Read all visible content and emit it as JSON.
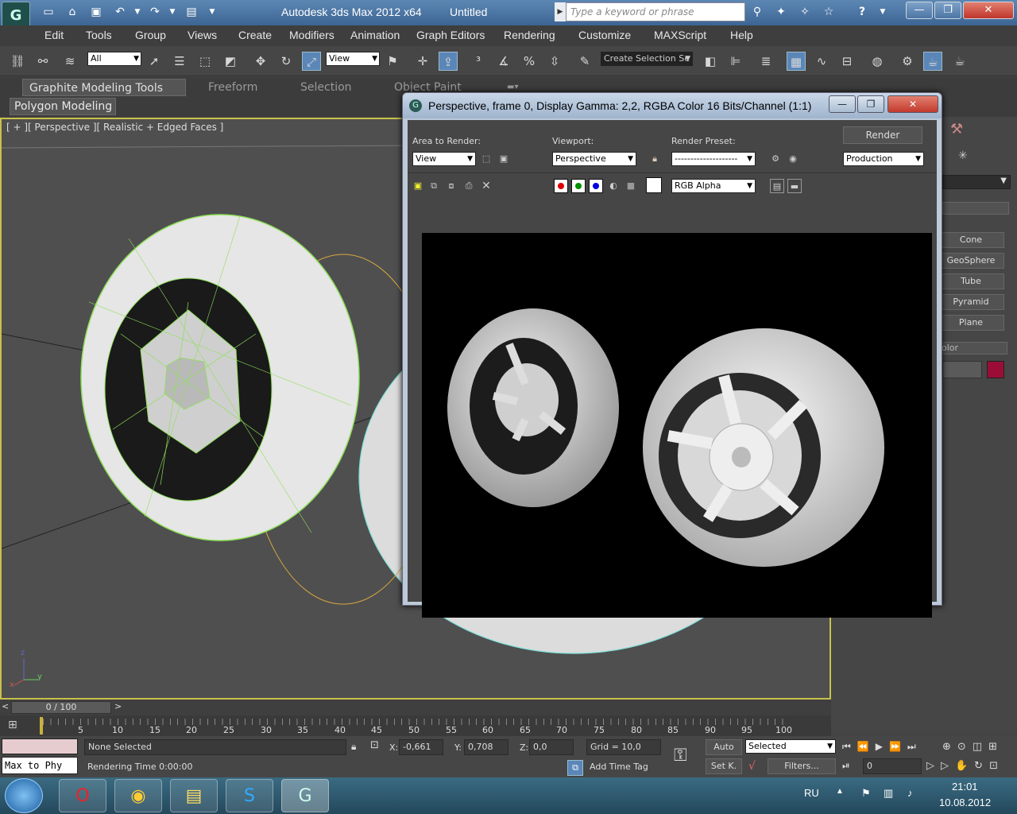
{
  "titlebar": {
    "app_title": "Autodesk 3ds Max  2012 x64",
    "doc_title": "Untitled",
    "search_placeholder": "Type a keyword or phrase",
    "logo_text": "G"
  },
  "menu": [
    "Edit",
    "Tools",
    "Group",
    "Views",
    "Create",
    "Modifiers",
    "Animation",
    "Graph Editors",
    "Rendering",
    "Customize",
    "MAXScript",
    "Help"
  ],
  "toolbar": {
    "selection_filter": "All",
    "reference_coord": "View",
    "named_selection": "Create Selection Se"
  },
  "ribbon": {
    "tabs": [
      "Graphite Modeling Tools",
      "Freeform",
      "Selection",
      "Object Paint"
    ],
    "active_tab": "Graphite Modeling Tools",
    "sub_panel": "Polygon Modeling"
  },
  "viewport": {
    "label": "[ + ][ Perspective ][ Realistic + Edged Faces ]",
    "axes": {
      "x": "x",
      "y": "y",
      "z": "z"
    }
  },
  "command_panel": {
    "object_buttons": [
      "Cone",
      "GeoSphere",
      "Tube",
      "Pyramid",
      "Plane"
    ],
    "color_label": "olor",
    "color_swatch": "#9b0d37"
  },
  "render_window": {
    "title": "Perspective, frame 0, Display Gamma: 2,2, RGBA Color 16 Bits/Channel (1:1)",
    "area_label": "Area to Render:",
    "area_value": "View",
    "viewport_label": "Viewport:",
    "viewport_value": "Perspective",
    "preset_label": "Render Preset:",
    "preset_value": "--------------------",
    "render_button": "Render",
    "production_value": "Production",
    "channel_value": "RGB Alpha",
    "channel_dots": [
      "#e00000",
      "#009000",
      "#0000e0"
    ]
  },
  "timeline": {
    "slider": "0 / 100",
    "ticks": [
      "5",
      "10",
      "15",
      "20",
      "25",
      "30",
      "35",
      "40",
      "45",
      "50",
      "55",
      "60",
      "65",
      "70",
      "75",
      "80",
      "85",
      "90",
      "95",
      "100"
    ]
  },
  "status": {
    "maxscript": "Max to Phy",
    "selection": "None Selected",
    "rendering_time": "Rendering Time  0:00:00",
    "x_label": "X:",
    "x_value": "-0,661",
    "y_label": "Y:",
    "y_value": "0,708",
    "z_label": "Z:",
    "z_value": "0,0",
    "grid": "Grid = 10,0",
    "add_time_tag": "Add Time Tag",
    "auto": "Auto",
    "set_key": "Set K.",
    "key_mode": "Selected",
    "filters": "Filters...",
    "frame_value": "0"
  },
  "taskbar": {
    "lang": "RU",
    "time": "21:01",
    "date": "10.08.2012"
  }
}
